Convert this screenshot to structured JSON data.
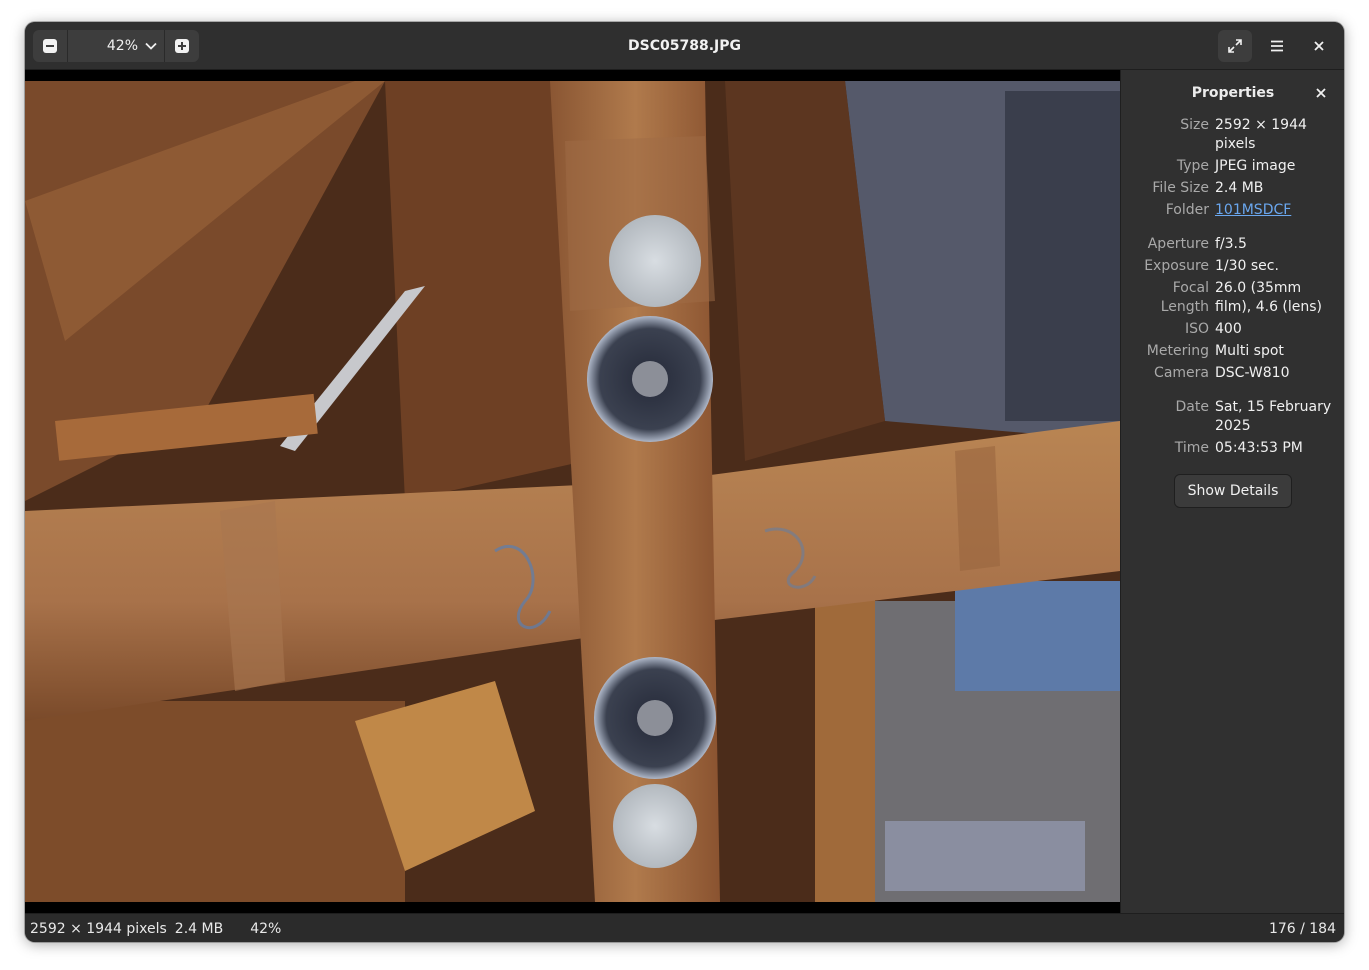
{
  "window": {
    "title": "DSC05788.JPG"
  },
  "toolbar": {
    "zoom_value": "42%",
    "zoom_out_icon": "minus-square-icon",
    "zoom_in_icon": "plus-square-icon",
    "dropdown_icon": "chevron-down-icon",
    "fullscreen_icon": "fullscreen-icon",
    "menu_icon": "hamburger-menu-icon",
    "close_icon": "close-icon"
  },
  "properties": {
    "heading": "Properties",
    "rows_file": [
      {
        "key": "Size",
        "value": "2592 × 1944 pixels"
      },
      {
        "key": "Type",
        "value": "JPEG image"
      },
      {
        "key": "File Size",
        "value": "2.4 MB"
      },
      {
        "key": "Folder",
        "value": "101MSDCF"
      }
    ],
    "rows_exif": [
      {
        "key": "Aperture",
        "value": "f/3.5"
      },
      {
        "key": "Exposure",
        "value": "1/30 sec."
      },
      {
        "key": "Focal Length",
        "value": "26.0 (35mm film), 4.6 (lens)"
      },
      {
        "key": "ISO",
        "value": "400"
      },
      {
        "key": "Metering",
        "value": "Multi spot"
      },
      {
        "key": "Camera",
        "value": "DSC-W810"
      }
    ],
    "rows_date": [
      {
        "key": "Date",
        "value": "Sat, 15 February 2025"
      },
      {
        "key": "Time",
        "value": "05:43:53 PM"
      }
    ],
    "show_details_label": "Show Details"
  },
  "statusbar": {
    "dimensions": "2592 × 1944 pixels",
    "file_size": "2.4 MB",
    "zoom": "42%",
    "position": "176 / 184"
  },
  "colors": {
    "link": "#6aa7ef",
    "background": "#2d2d2d"
  }
}
